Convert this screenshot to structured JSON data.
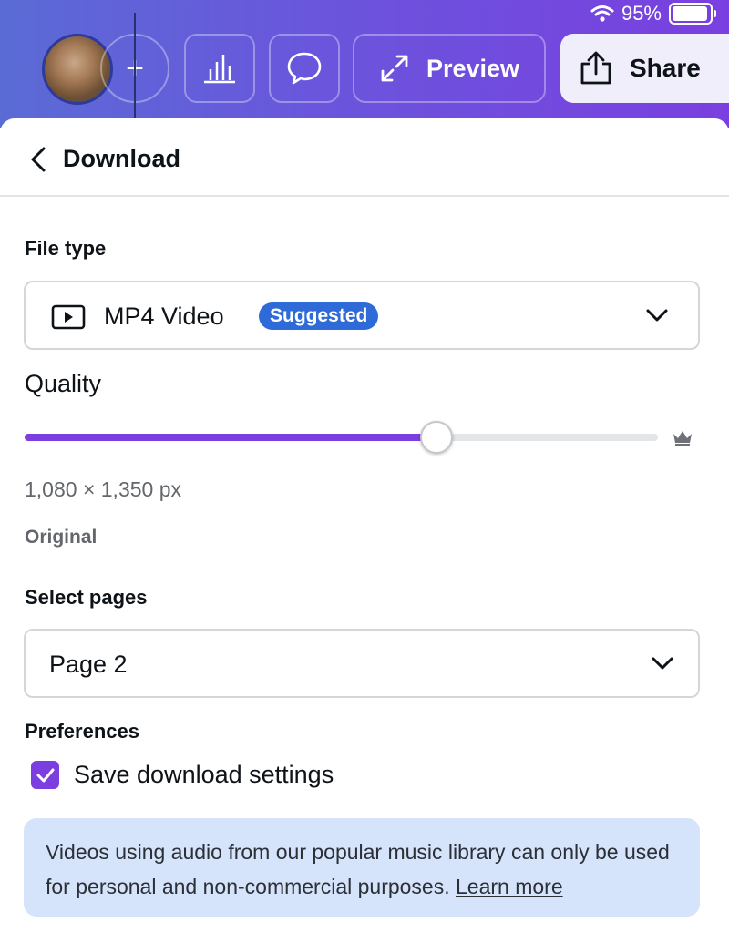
{
  "status": {
    "battery": "95%",
    "battery_level": 0.95
  },
  "toolbar": {
    "add_label": "+",
    "preview_label": "Preview",
    "share_label": "Share"
  },
  "panel": {
    "title": "Download",
    "file_type": {
      "label": "File type",
      "value": "MP4 Video",
      "badge": "Suggested"
    },
    "quality": {
      "label": "Quality",
      "slider_value": 0.65,
      "dimensions": "1,080 × 1,350 px",
      "preset": "Original"
    },
    "pages": {
      "label": "Select pages",
      "value": "Page 2"
    },
    "preferences": {
      "label": "Preferences",
      "checkbox_label": "Save download settings",
      "checked": true
    },
    "notice": {
      "text": "Videos using audio from our popular music library can only be used for personal and non-commercial purposes.",
      "link": "Learn more"
    }
  },
  "colors": {
    "accent": "#7d3ee0",
    "badge": "#2f6bd8",
    "notice_bg": "#d5e3fb"
  }
}
